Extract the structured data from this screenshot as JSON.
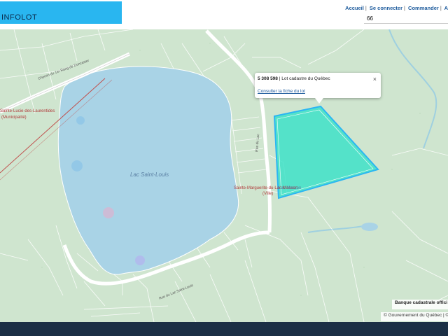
{
  "header": {
    "logo_text": "INFOLOT",
    "nav": [
      {
        "label": "Accueil"
      },
      {
        "label": "Se connecter"
      },
      {
        "label": "Commander"
      },
      {
        "label": "A"
      }
    ],
    "search_value": "66"
  },
  "map": {
    "road_labels": {
      "chemin": "Chemin du 1er Rang de Doncaster",
      "rue_lac": "Rue du Lac Saint-Louis",
      "rue_vertical": "Rue du Lac"
    },
    "place_labels": {
      "lake": "Lac Saint-Louis",
      "ste_marguerite": "Sainte-Marguerite-du-Lac-Masson",
      "ville": "(Ville)",
      "ste_lucie": "Sainte-Lucie-des-Laurentides",
      "municipalite": "(Municipalité)",
      "lac_masson": "Lac Masson"
    },
    "colors": {
      "land": "#cfe5cf",
      "water": "#a9d3e6",
      "selection_fill": "#3ee2c8",
      "selection_stroke": "#2bb6f2",
      "parcel_line": "#ffffff",
      "boundary_red": "#c0504d"
    }
  },
  "popup": {
    "lot_number": "5 308 598",
    "lot_type": "| Lot cadastre du Québec",
    "link": "Consulter la fiche du lot",
    "close": "×"
  },
  "attribution": {
    "source": "Banque cadastrale offici",
    "copyright": "© Gouvernement du Québec | ©"
  }
}
